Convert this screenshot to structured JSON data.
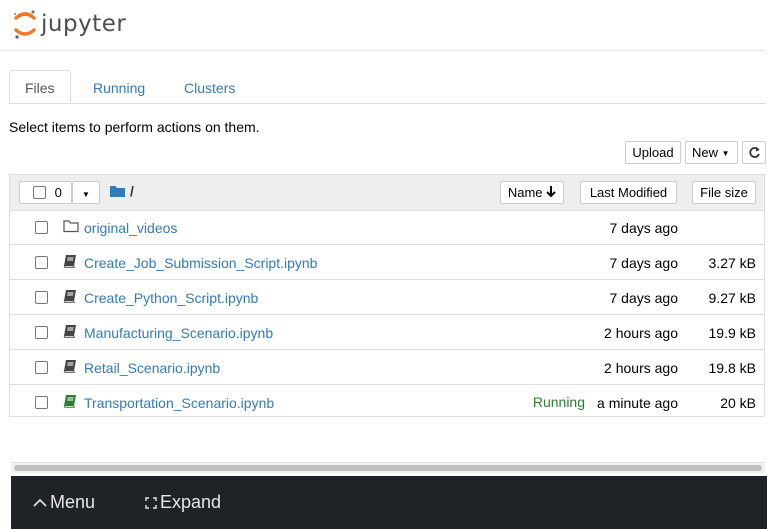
{
  "app": {
    "logo_text": "jupyter"
  },
  "tabs": [
    {
      "label": "Files",
      "active": true
    },
    {
      "label": "Running",
      "active": false
    },
    {
      "label": "Clusters",
      "active": false
    }
  ],
  "instruction": "Select items to perform actions on them.",
  "toolbar": {
    "upload_label": "Upload",
    "new_label": "New"
  },
  "list_header": {
    "selected_count": "0",
    "breadcrumb": "/",
    "sort_name_label": "Name",
    "last_modified_label": "Last Modified",
    "file_size_label": "File size"
  },
  "files": [
    {
      "name": "original_videos",
      "type": "folder",
      "status": "",
      "modified": "7 days ago",
      "size": ""
    },
    {
      "name": "Create_Job_Submission_Script.ipynb",
      "type": "notebook",
      "status": "",
      "modified": "7 days ago",
      "size": "3.27 kB"
    },
    {
      "name": "Create_Python_Script.ipynb",
      "type": "notebook",
      "status": "",
      "modified": "7 days ago",
      "size": "9.27 kB"
    },
    {
      "name": "Manufacturing_Scenario.ipynb",
      "type": "notebook",
      "status": "",
      "modified": "2 hours ago",
      "size": "19.9 kB"
    },
    {
      "name": "Retail_Scenario.ipynb",
      "type": "notebook",
      "status": "",
      "modified": "2 hours ago",
      "size": "19.8 kB"
    },
    {
      "name": "Transportation_Scenario.ipynb",
      "type": "notebook-running",
      "status": "Running",
      "modified": "a minute ago",
      "size": "20 kB"
    }
  ],
  "bottom_bar": {
    "menu_label": "Menu",
    "expand_label": "Expand"
  },
  "colors": {
    "link": "#337ab7",
    "running": "#2e7d32",
    "bottombar": "#1f2328",
    "logo_orange": "#f37726"
  }
}
